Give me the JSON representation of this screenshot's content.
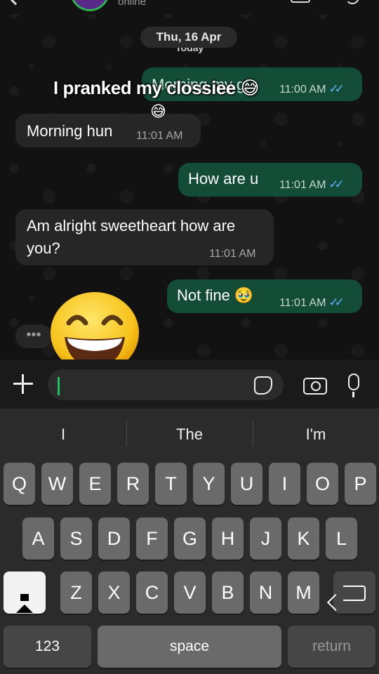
{
  "header": {
    "status": "online"
  },
  "chat": {
    "date": "Thu, 16 Apr",
    "date_under": "Today",
    "caption_overlay": "I pranked my clossiee 😅",
    "caption_emoji": "😅",
    "messages": [
      {
        "dir": "out",
        "text": "Morning my g!",
        "time": "11:00 AM",
        "ticks": "✓✓"
      },
      {
        "dir": "in",
        "text": "Morning hun",
        "time": "11:01 AM"
      },
      {
        "dir": "out",
        "text": "How are u",
        "time": "11:01 AM",
        "ticks": "✓✓"
      },
      {
        "dir": "in",
        "line1": "Am alright sweetheart how are",
        "line2": "you?",
        "time": "11:01 AM"
      },
      {
        "dir": "out",
        "text": "Not fine 🥹",
        "time": "11:01 AM",
        "ticks": "✓✓"
      }
    ],
    "typing_indicator": "•••"
  },
  "composer": {
    "placeholder": ""
  },
  "keyboard": {
    "suggestions": [
      "I",
      "The",
      "I'm"
    ],
    "row1": [
      "Q",
      "W",
      "E",
      "R",
      "T",
      "Y",
      "U",
      "I",
      "O",
      "P"
    ],
    "row2": [
      "A",
      "S",
      "D",
      "F",
      "G",
      "H",
      "J",
      "K",
      "L"
    ],
    "row3": [
      "Z",
      "X",
      "C",
      "V",
      "B",
      "N",
      "M"
    ],
    "numbers_label": "123",
    "space_label": "space",
    "return_label": "return"
  },
  "colors": {
    "outgoing_bubble": "#144d37",
    "incoming_bubble": "#262626",
    "read_tick": "#5cb0ff",
    "caret": "#21c063"
  },
  "icons": [
    "back-icon",
    "video-call-icon",
    "phone-icon",
    "plus-icon",
    "sticker-icon",
    "camera-icon",
    "microphone-icon",
    "shift-icon",
    "backspace-icon",
    "grinning-emoji"
  ]
}
